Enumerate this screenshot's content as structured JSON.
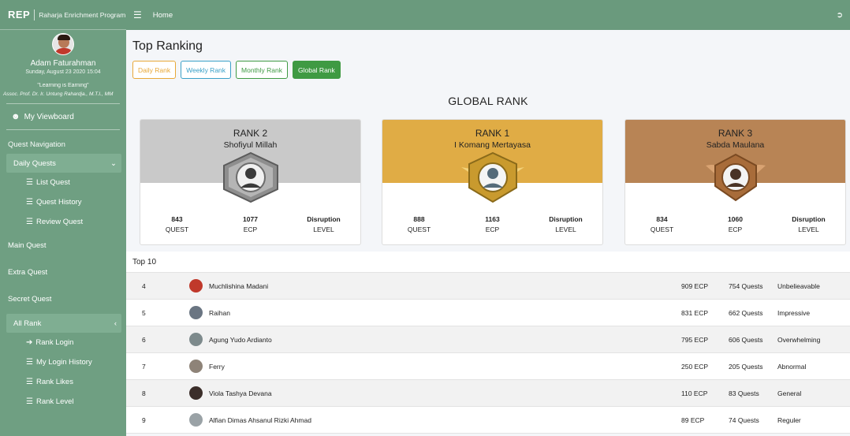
{
  "brand": {
    "logo": "REP",
    "name": "Raharja Enrichment Program"
  },
  "profile": {
    "name": "Adam Faturahman",
    "date": "Sunday, August 23 2020 15:04",
    "quote": "\"Learning is Earning\"",
    "supervisor": "Assoc. Prof. Dr. Ir. Untung Rahardja., M.T.I., MM"
  },
  "sidebar": {
    "viewboard": "My Viewboard",
    "section_quest": "Quest Navigation",
    "daily_quests": "Daily Quests",
    "daily_items": [
      "List Quest",
      "Quest History",
      "Review Quest"
    ],
    "main_quest": "Main Quest",
    "extra_quest": "Extra Quest",
    "secret_quest": "Secret Quest",
    "all_rank": "All Rank",
    "rank_items": [
      "Rank Login",
      "My Login History",
      "Rank Likes",
      "Rank Level"
    ]
  },
  "topnav": {
    "home": "Home"
  },
  "page": {
    "title": "Top Ranking",
    "tabs": [
      "Daily Rank",
      "Weekly Rank",
      "Monthly Rank",
      "Global Rank"
    ],
    "section_title": "GLOBAL RANK"
  },
  "podium": [
    {
      "rank": "RANK 2",
      "name": "Shofiyul Millah",
      "quest": "843",
      "ecp": "1077",
      "level": "Disruption",
      "color": "#c9c9c9"
    },
    {
      "rank": "RANK 1",
      "name": "I Komang Mertayasa",
      "quest": "888",
      "ecp": "1163",
      "level": "Disruption",
      "color": "#e0ac45"
    },
    {
      "rank": "RANK 3",
      "name": "Sabda Maulana",
      "quest": "834",
      "ecp": "1060",
      "level": "Disruption",
      "color": "#b88455"
    }
  ],
  "podium_labels": {
    "quest": "QUEST",
    "ecp": "ECP",
    "level": "LEVEL"
  },
  "top10": {
    "title": "Top 10",
    "rows": [
      {
        "rank": "4",
        "name": "Muchlishina Madani",
        "ecp": "909 ECP",
        "quests": "754 Quests",
        "level": "Unbelieavable"
      },
      {
        "rank": "5",
        "name": "Raihan",
        "ecp": "831 ECP",
        "quests": "662 Quests",
        "level": "Impressive"
      },
      {
        "rank": "6",
        "name": "Agung Yudo Ardianto",
        "ecp": "795 ECP",
        "quests": "606 Quests",
        "level": "Overwhelming"
      },
      {
        "rank": "7",
        "name": "Ferry",
        "ecp": "250 ECP",
        "quests": "205 Quests",
        "level": "Abnormal"
      },
      {
        "rank": "8",
        "name": "Viola Tashya Devana",
        "ecp": "110 ECP",
        "quests": "83 Quests",
        "level": "General"
      },
      {
        "rank": "9",
        "name": "Alfian Dimas Ahsanul Rizki Ahmad",
        "ecp": "89 ECP",
        "quests": "74 Quests",
        "level": "Reguler"
      }
    ]
  },
  "colors": {
    "sidebar": "#6f9f82",
    "topnav": "#6a9a7d",
    "accent_green": "#3f9a43",
    "daily": "#e8a838",
    "weekly": "#3aa0c8"
  }
}
